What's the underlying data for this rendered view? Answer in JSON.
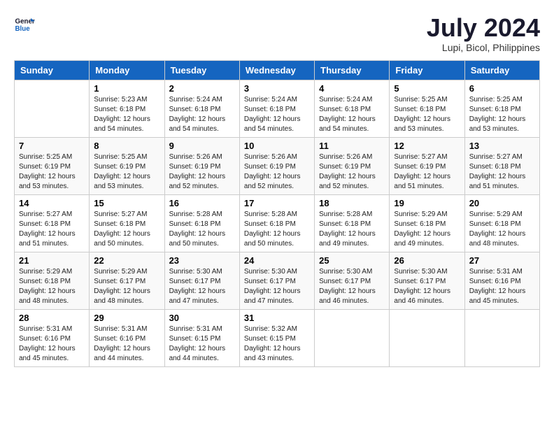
{
  "header": {
    "logo_line1": "General",
    "logo_line2": "Blue",
    "month_title": "July 2024",
    "location": "Lupi, Bicol, Philippines"
  },
  "days_of_week": [
    "Sunday",
    "Monday",
    "Tuesday",
    "Wednesday",
    "Thursday",
    "Friday",
    "Saturday"
  ],
  "weeks": [
    [
      {
        "num": "",
        "sunrise": "",
        "sunset": "",
        "daylight": ""
      },
      {
        "num": "1",
        "sunrise": "Sunrise: 5:23 AM",
        "sunset": "Sunset: 6:18 PM",
        "daylight": "Daylight: 12 hours and 54 minutes."
      },
      {
        "num": "2",
        "sunrise": "Sunrise: 5:24 AM",
        "sunset": "Sunset: 6:18 PM",
        "daylight": "Daylight: 12 hours and 54 minutes."
      },
      {
        "num": "3",
        "sunrise": "Sunrise: 5:24 AM",
        "sunset": "Sunset: 6:18 PM",
        "daylight": "Daylight: 12 hours and 54 minutes."
      },
      {
        "num": "4",
        "sunrise": "Sunrise: 5:24 AM",
        "sunset": "Sunset: 6:18 PM",
        "daylight": "Daylight: 12 hours and 54 minutes."
      },
      {
        "num": "5",
        "sunrise": "Sunrise: 5:25 AM",
        "sunset": "Sunset: 6:18 PM",
        "daylight": "Daylight: 12 hours and 53 minutes."
      },
      {
        "num": "6",
        "sunrise": "Sunrise: 5:25 AM",
        "sunset": "Sunset: 6:18 PM",
        "daylight": "Daylight: 12 hours and 53 minutes."
      }
    ],
    [
      {
        "num": "7",
        "sunrise": "Sunrise: 5:25 AM",
        "sunset": "Sunset: 6:19 PM",
        "daylight": "Daylight: 12 hours and 53 minutes."
      },
      {
        "num": "8",
        "sunrise": "Sunrise: 5:25 AM",
        "sunset": "Sunset: 6:19 PM",
        "daylight": "Daylight: 12 hours and 53 minutes."
      },
      {
        "num": "9",
        "sunrise": "Sunrise: 5:26 AM",
        "sunset": "Sunset: 6:19 PM",
        "daylight": "Daylight: 12 hours and 52 minutes."
      },
      {
        "num": "10",
        "sunrise": "Sunrise: 5:26 AM",
        "sunset": "Sunset: 6:19 PM",
        "daylight": "Daylight: 12 hours and 52 minutes."
      },
      {
        "num": "11",
        "sunrise": "Sunrise: 5:26 AM",
        "sunset": "Sunset: 6:19 PM",
        "daylight": "Daylight: 12 hours and 52 minutes."
      },
      {
        "num": "12",
        "sunrise": "Sunrise: 5:27 AM",
        "sunset": "Sunset: 6:19 PM",
        "daylight": "Daylight: 12 hours and 51 minutes."
      },
      {
        "num": "13",
        "sunrise": "Sunrise: 5:27 AM",
        "sunset": "Sunset: 6:18 PM",
        "daylight": "Daylight: 12 hours and 51 minutes."
      }
    ],
    [
      {
        "num": "14",
        "sunrise": "Sunrise: 5:27 AM",
        "sunset": "Sunset: 6:18 PM",
        "daylight": "Daylight: 12 hours and 51 minutes."
      },
      {
        "num": "15",
        "sunrise": "Sunrise: 5:27 AM",
        "sunset": "Sunset: 6:18 PM",
        "daylight": "Daylight: 12 hours and 50 minutes."
      },
      {
        "num": "16",
        "sunrise": "Sunrise: 5:28 AM",
        "sunset": "Sunset: 6:18 PM",
        "daylight": "Daylight: 12 hours and 50 minutes."
      },
      {
        "num": "17",
        "sunrise": "Sunrise: 5:28 AM",
        "sunset": "Sunset: 6:18 PM",
        "daylight": "Daylight: 12 hours and 50 minutes."
      },
      {
        "num": "18",
        "sunrise": "Sunrise: 5:28 AM",
        "sunset": "Sunset: 6:18 PM",
        "daylight": "Daylight: 12 hours and 49 minutes."
      },
      {
        "num": "19",
        "sunrise": "Sunrise: 5:29 AM",
        "sunset": "Sunset: 6:18 PM",
        "daylight": "Daylight: 12 hours and 49 minutes."
      },
      {
        "num": "20",
        "sunrise": "Sunrise: 5:29 AM",
        "sunset": "Sunset: 6:18 PM",
        "daylight": "Daylight: 12 hours and 48 minutes."
      }
    ],
    [
      {
        "num": "21",
        "sunrise": "Sunrise: 5:29 AM",
        "sunset": "Sunset: 6:18 PM",
        "daylight": "Daylight: 12 hours and 48 minutes."
      },
      {
        "num": "22",
        "sunrise": "Sunrise: 5:29 AM",
        "sunset": "Sunset: 6:17 PM",
        "daylight": "Daylight: 12 hours and 48 minutes."
      },
      {
        "num": "23",
        "sunrise": "Sunrise: 5:30 AM",
        "sunset": "Sunset: 6:17 PM",
        "daylight": "Daylight: 12 hours and 47 minutes."
      },
      {
        "num": "24",
        "sunrise": "Sunrise: 5:30 AM",
        "sunset": "Sunset: 6:17 PM",
        "daylight": "Daylight: 12 hours and 47 minutes."
      },
      {
        "num": "25",
        "sunrise": "Sunrise: 5:30 AM",
        "sunset": "Sunset: 6:17 PM",
        "daylight": "Daylight: 12 hours and 46 minutes."
      },
      {
        "num": "26",
        "sunrise": "Sunrise: 5:30 AM",
        "sunset": "Sunset: 6:17 PM",
        "daylight": "Daylight: 12 hours and 46 minutes."
      },
      {
        "num": "27",
        "sunrise": "Sunrise: 5:31 AM",
        "sunset": "Sunset: 6:16 PM",
        "daylight": "Daylight: 12 hours and 45 minutes."
      }
    ],
    [
      {
        "num": "28",
        "sunrise": "Sunrise: 5:31 AM",
        "sunset": "Sunset: 6:16 PM",
        "daylight": "Daylight: 12 hours and 45 minutes."
      },
      {
        "num": "29",
        "sunrise": "Sunrise: 5:31 AM",
        "sunset": "Sunset: 6:16 PM",
        "daylight": "Daylight: 12 hours and 44 minutes."
      },
      {
        "num": "30",
        "sunrise": "Sunrise: 5:31 AM",
        "sunset": "Sunset: 6:15 PM",
        "daylight": "Daylight: 12 hours and 44 minutes."
      },
      {
        "num": "31",
        "sunrise": "Sunrise: 5:32 AM",
        "sunset": "Sunset: 6:15 PM",
        "daylight": "Daylight: 12 hours and 43 minutes."
      },
      {
        "num": "",
        "sunrise": "",
        "sunset": "",
        "daylight": ""
      },
      {
        "num": "",
        "sunrise": "",
        "sunset": "",
        "daylight": ""
      },
      {
        "num": "",
        "sunrise": "",
        "sunset": "",
        "daylight": ""
      }
    ]
  ]
}
